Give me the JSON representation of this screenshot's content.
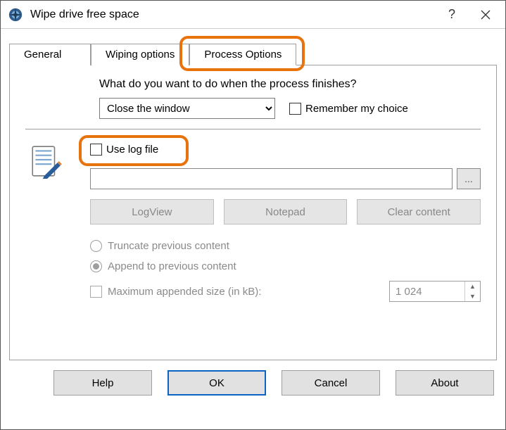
{
  "window": {
    "title": "Wipe drive free space"
  },
  "tabs": {
    "general": "General",
    "wiping": "Wiping options",
    "process": "Process Options"
  },
  "process": {
    "heading": "What do you want to do when the process finishes?",
    "action_options": [
      "Close the window"
    ],
    "action_selected": "Close the window",
    "remember_label": "Remember my choice",
    "use_log_label": "Use log file",
    "log_path": "",
    "browse_label": "...",
    "buttons": {
      "logview": "LogView",
      "notepad": "Notepad",
      "clear": "Clear content"
    },
    "radio_truncate": "Truncate previous content",
    "radio_append": "Append to previous content",
    "max_size_label": "Maximum appended size (in kB):",
    "max_size_value": "1 024"
  },
  "footer": {
    "help": "Help",
    "ok": "OK",
    "cancel": "Cancel",
    "about": "About"
  }
}
